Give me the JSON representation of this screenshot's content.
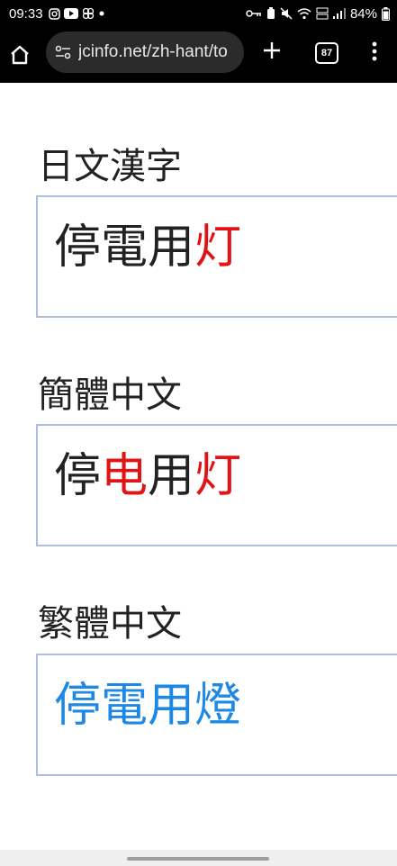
{
  "status_bar": {
    "time": "09:33",
    "battery": "84%"
  },
  "browser": {
    "url": "jcinfo.net/zh-hant/to",
    "tab_count": "87"
  },
  "sections": [
    {
      "label": "日文漢字",
      "chars": [
        {
          "t": "停",
          "color": "#222222"
        },
        {
          "t": "電",
          "color": "#222222"
        },
        {
          "t": "用",
          "color": "#222222"
        },
        {
          "t": "灯",
          "color": "#e01414"
        }
      ]
    },
    {
      "label": "簡體中文",
      "chars": [
        {
          "t": "停",
          "color": "#222222"
        },
        {
          "t": "电",
          "color": "#e01414"
        },
        {
          "t": "用",
          "color": "#222222"
        },
        {
          "t": "灯",
          "color": "#e01414"
        }
      ]
    },
    {
      "label": "繁體中文",
      "chars": [
        {
          "t": "停",
          "color": "#1e88e5"
        },
        {
          "t": "電",
          "color": "#1e88e5"
        },
        {
          "t": "用",
          "color": "#1e88e5"
        },
        {
          "t": "燈",
          "color": "#1e88e5"
        }
      ]
    }
  ]
}
